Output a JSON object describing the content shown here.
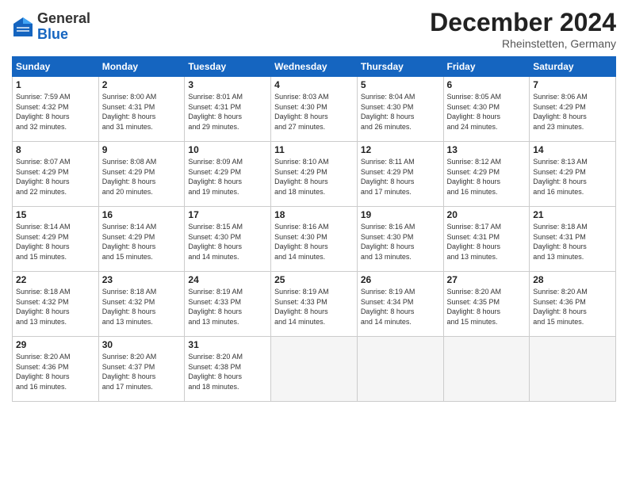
{
  "logo": {
    "text_general": "General",
    "text_blue": "Blue"
  },
  "title": "December 2024",
  "location": "Rheinstetten, Germany",
  "weekdays": [
    "Sunday",
    "Monday",
    "Tuesday",
    "Wednesday",
    "Thursday",
    "Friday",
    "Saturday"
  ],
  "days": [
    {
      "num": "",
      "info": ""
    },
    {
      "num": "",
      "info": ""
    },
    {
      "num": "",
      "info": ""
    },
    {
      "num": "",
      "info": ""
    },
    {
      "num": "",
      "info": ""
    },
    {
      "num": "",
      "info": ""
    },
    {
      "num": "1",
      "info": "Sunrise: 7:59 AM\nSunset: 4:32 PM\nDaylight: 8 hours\nand 32 minutes."
    },
    {
      "num": "2",
      "info": "Sunrise: 8:00 AM\nSunset: 4:31 PM\nDaylight: 8 hours\nand 31 minutes."
    },
    {
      "num": "3",
      "info": "Sunrise: 8:01 AM\nSunset: 4:31 PM\nDaylight: 8 hours\nand 29 minutes."
    },
    {
      "num": "4",
      "info": "Sunrise: 8:03 AM\nSunset: 4:30 PM\nDaylight: 8 hours\nand 27 minutes."
    },
    {
      "num": "5",
      "info": "Sunrise: 8:04 AM\nSunset: 4:30 PM\nDaylight: 8 hours\nand 26 minutes."
    },
    {
      "num": "6",
      "info": "Sunrise: 8:05 AM\nSunset: 4:30 PM\nDaylight: 8 hours\nand 24 minutes."
    },
    {
      "num": "7",
      "info": "Sunrise: 8:06 AM\nSunset: 4:29 PM\nDaylight: 8 hours\nand 23 minutes."
    },
    {
      "num": "8",
      "info": "Sunrise: 8:07 AM\nSunset: 4:29 PM\nDaylight: 8 hours\nand 22 minutes."
    },
    {
      "num": "9",
      "info": "Sunrise: 8:08 AM\nSunset: 4:29 PM\nDaylight: 8 hours\nand 20 minutes."
    },
    {
      "num": "10",
      "info": "Sunrise: 8:09 AM\nSunset: 4:29 PM\nDaylight: 8 hours\nand 19 minutes."
    },
    {
      "num": "11",
      "info": "Sunrise: 8:10 AM\nSunset: 4:29 PM\nDaylight: 8 hours\nand 18 minutes."
    },
    {
      "num": "12",
      "info": "Sunrise: 8:11 AM\nSunset: 4:29 PM\nDaylight: 8 hours\nand 17 minutes."
    },
    {
      "num": "13",
      "info": "Sunrise: 8:12 AM\nSunset: 4:29 PM\nDaylight: 8 hours\nand 16 minutes."
    },
    {
      "num": "14",
      "info": "Sunrise: 8:13 AM\nSunset: 4:29 PM\nDaylight: 8 hours\nand 16 minutes."
    },
    {
      "num": "15",
      "info": "Sunrise: 8:14 AM\nSunset: 4:29 PM\nDaylight: 8 hours\nand 15 minutes."
    },
    {
      "num": "16",
      "info": "Sunrise: 8:14 AM\nSunset: 4:29 PM\nDaylight: 8 hours\nand 15 minutes."
    },
    {
      "num": "17",
      "info": "Sunrise: 8:15 AM\nSunset: 4:30 PM\nDaylight: 8 hours\nand 14 minutes."
    },
    {
      "num": "18",
      "info": "Sunrise: 8:16 AM\nSunset: 4:30 PM\nDaylight: 8 hours\nand 14 minutes."
    },
    {
      "num": "19",
      "info": "Sunrise: 8:16 AM\nSunset: 4:30 PM\nDaylight: 8 hours\nand 13 minutes."
    },
    {
      "num": "20",
      "info": "Sunrise: 8:17 AM\nSunset: 4:31 PM\nDaylight: 8 hours\nand 13 minutes."
    },
    {
      "num": "21",
      "info": "Sunrise: 8:18 AM\nSunset: 4:31 PM\nDaylight: 8 hours\nand 13 minutes."
    },
    {
      "num": "22",
      "info": "Sunrise: 8:18 AM\nSunset: 4:32 PM\nDaylight: 8 hours\nand 13 minutes."
    },
    {
      "num": "23",
      "info": "Sunrise: 8:18 AM\nSunset: 4:32 PM\nDaylight: 8 hours\nand 13 minutes."
    },
    {
      "num": "24",
      "info": "Sunrise: 8:19 AM\nSunset: 4:33 PM\nDaylight: 8 hours\nand 13 minutes."
    },
    {
      "num": "25",
      "info": "Sunrise: 8:19 AM\nSunset: 4:33 PM\nDaylight: 8 hours\nand 14 minutes."
    },
    {
      "num": "26",
      "info": "Sunrise: 8:19 AM\nSunset: 4:34 PM\nDaylight: 8 hours\nand 14 minutes."
    },
    {
      "num": "27",
      "info": "Sunrise: 8:20 AM\nSunset: 4:35 PM\nDaylight: 8 hours\nand 15 minutes."
    },
    {
      "num": "28",
      "info": "Sunrise: 8:20 AM\nSunset: 4:36 PM\nDaylight: 8 hours\nand 15 minutes."
    },
    {
      "num": "29",
      "info": "Sunrise: 8:20 AM\nSunset: 4:36 PM\nDaylight: 8 hours\nand 16 minutes."
    },
    {
      "num": "30",
      "info": "Sunrise: 8:20 AM\nSunset: 4:37 PM\nDaylight: 8 hours\nand 17 minutes."
    },
    {
      "num": "31",
      "info": "Sunrise: 8:20 AM\nSunset: 4:38 PM\nDaylight: 8 hours\nand 18 minutes."
    },
    {
      "num": "",
      "info": ""
    },
    {
      "num": "",
      "info": ""
    },
    {
      "num": "",
      "info": ""
    },
    {
      "num": "",
      "info": ""
    }
  ]
}
